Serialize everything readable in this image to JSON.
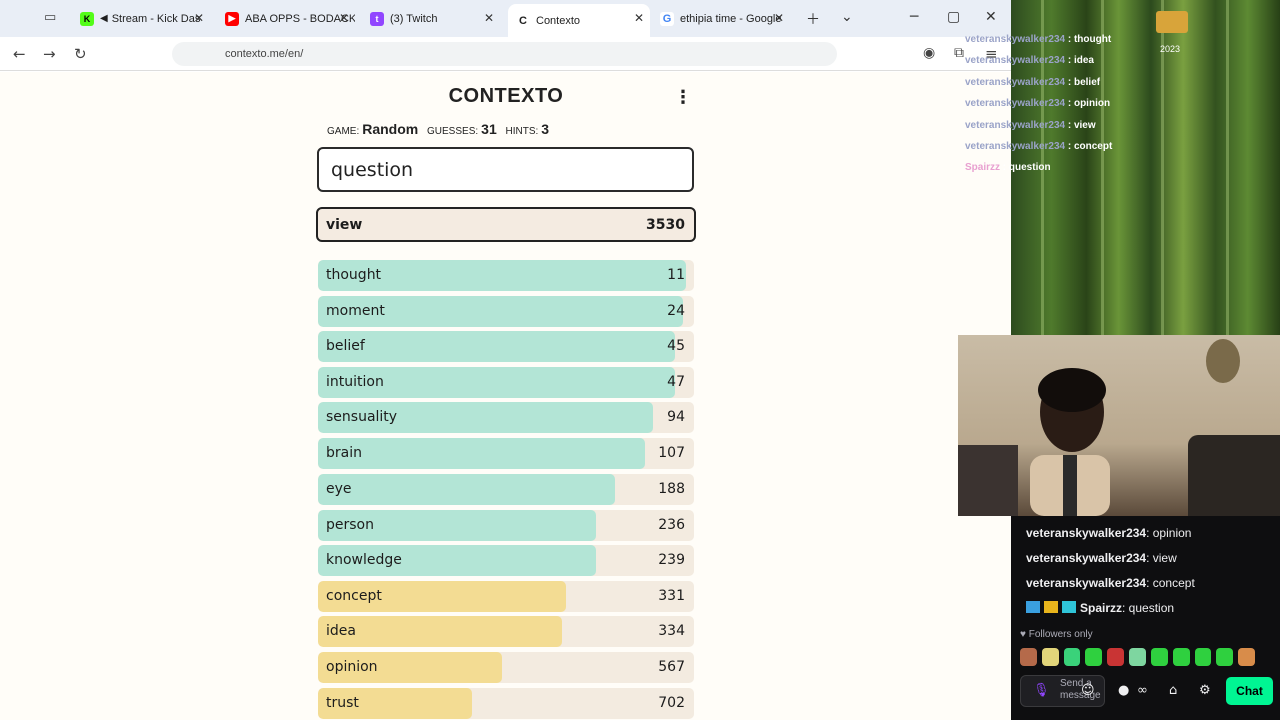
{
  "browser": {
    "tabs": [
      {
        "title": "Stream - Kick Das",
        "favicon": "kick-icon",
        "color": "#53fc18"
      },
      {
        "title": "ABA OPPS - BODACK",
        "favicon": "youtube-icon",
        "color": "#ff0000"
      },
      {
        "title": "(3) Twitch",
        "favicon": "twitch-icon",
        "color": "#9146ff"
      },
      {
        "title": "Contexto",
        "favicon": "contexto-icon",
        "color": "#222222"
      },
      {
        "title": "ethipia time - Google",
        "favicon": "google-icon",
        "color": "#4285f4"
      }
    ],
    "url": "contexto.me/en/"
  },
  "game": {
    "title": "CONTEXTO",
    "game_label": "GAME:",
    "game_value": "Random",
    "guesses_label": "GUESSES:",
    "guesses_value": "31",
    "hints_label": "HINTS:",
    "hints_value": "3",
    "input_value": "question",
    "last_guess": {
      "word": "view",
      "rank": "3530"
    },
    "guesses": [
      {
        "word": "thought",
        "rank": "11",
        "fill": 0.98,
        "color": "#b3e5d6"
      },
      {
        "word": "moment",
        "rank": "24",
        "fill": 0.97,
        "color": "#b3e5d6"
      },
      {
        "word": "belief",
        "rank": "45",
        "fill": 0.95,
        "color": "#b3e5d6"
      },
      {
        "word": "intuition",
        "rank": "47",
        "fill": 0.95,
        "color": "#b3e5d6"
      },
      {
        "word": "sensuality",
        "rank": "94",
        "fill": 0.89,
        "color": "#b3e5d6"
      },
      {
        "word": "brain",
        "rank": "107",
        "fill": 0.87,
        "color": "#b3e5d6"
      },
      {
        "word": "eye",
        "rank": "188",
        "fill": 0.79,
        "color": "#b3e5d6"
      },
      {
        "word": "person",
        "rank": "236",
        "fill": 0.74,
        "color": "#b3e5d6"
      },
      {
        "word": "knowledge",
        "rank": "239",
        "fill": 0.74,
        "color": "#b3e5d6"
      },
      {
        "word": "concept",
        "rank": "331",
        "fill": 0.66,
        "color": "#f3dc93"
      },
      {
        "word": "idea",
        "rank": "334",
        "fill": 0.65,
        "color": "#f3dc93"
      },
      {
        "word": "opinion",
        "rank": "567",
        "fill": 0.49,
        "color": "#f3dc93"
      },
      {
        "word": "trust",
        "rank": "702",
        "fill": 0.41,
        "color": "#f3dc93"
      }
    ]
  },
  "overlay": {
    "year": "2023",
    "chat": [
      {
        "user": "veteranskywalker234",
        "text": " : thought"
      },
      {
        "user": "veteranskywalker234",
        "text": " : idea"
      },
      {
        "user": "veteranskywalker234",
        "text": " : belief"
      },
      {
        "user": "veteranskywalker234",
        "text": " : opinion"
      },
      {
        "user": "veteranskywalker234",
        "text": " : view"
      },
      {
        "user": "veteranskywalker234",
        "text": " : concept"
      },
      {
        "user": "Spairzz",
        "text": " : question"
      }
    ]
  },
  "chat": {
    "messages": [
      {
        "user": "veteranskywalker234",
        "text": ": opinion",
        "color": "#efeff1"
      },
      {
        "user": "veteranskywalker234",
        "text": ": view",
        "color": "#efeff1"
      },
      {
        "user": "veteranskywalker234",
        "text": ": concept",
        "color": "#efeff1"
      },
      {
        "user": "Spairzz",
        "text": ": question",
        "color": "#efeff1"
      }
    ],
    "followers_only": "Followers only",
    "send_placeholder": "Send a message",
    "chat_button": "Chat"
  }
}
